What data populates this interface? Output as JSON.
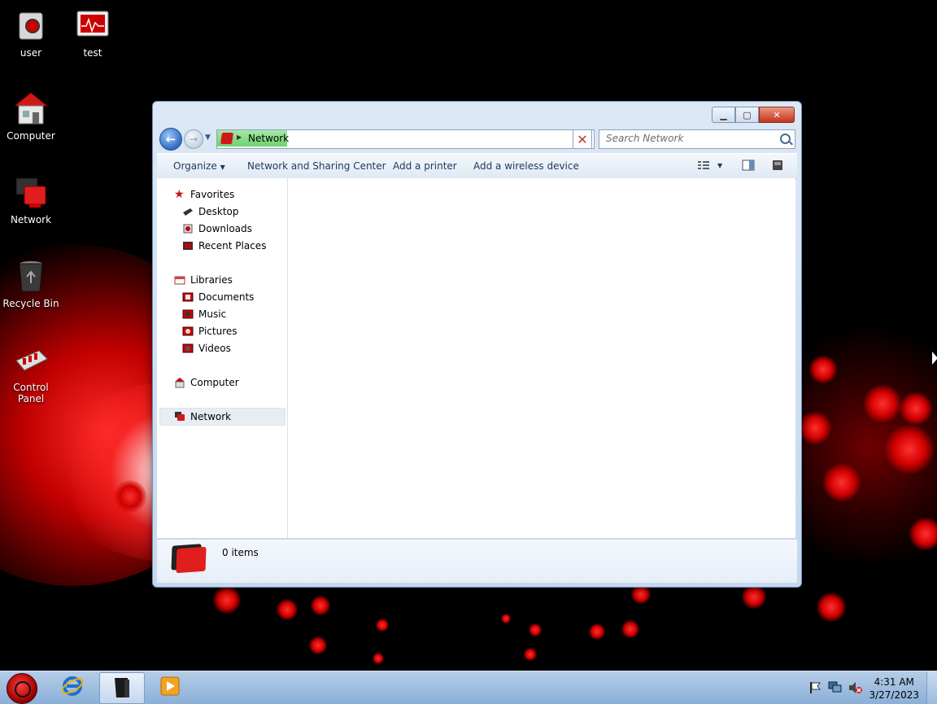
{
  "desktop": {
    "icons": [
      {
        "label": "user"
      },
      {
        "label": "test"
      },
      {
        "label": "Computer"
      },
      {
        "label": "Network"
      },
      {
        "label": "Recycle Bin"
      },
      {
        "label": "Control Panel"
      }
    ]
  },
  "window": {
    "address": {
      "location": "Network"
    },
    "search": {
      "placeholder": "Search Network"
    },
    "commands": {
      "organize": "Organize",
      "sharing_center": "Network and Sharing Center",
      "add_printer": "Add a printer",
      "add_wireless": "Add a wireless device"
    },
    "nav": {
      "favorites": "Favorites",
      "desktop": "Desktop",
      "downloads": "Downloads",
      "recent_places": "Recent Places",
      "libraries": "Libraries",
      "documents": "Documents",
      "music": "Music",
      "pictures": "Pictures",
      "videos": "Videos",
      "computer": "Computer",
      "network": "Network"
    },
    "details": {
      "item_count": "0 items"
    }
  },
  "taskbar": {
    "clock": {
      "time": "4:31 AM",
      "date": "3/27/2023"
    }
  },
  "colors": {
    "accent": "#d01818",
    "taskbar": "#9dbbe0"
  }
}
